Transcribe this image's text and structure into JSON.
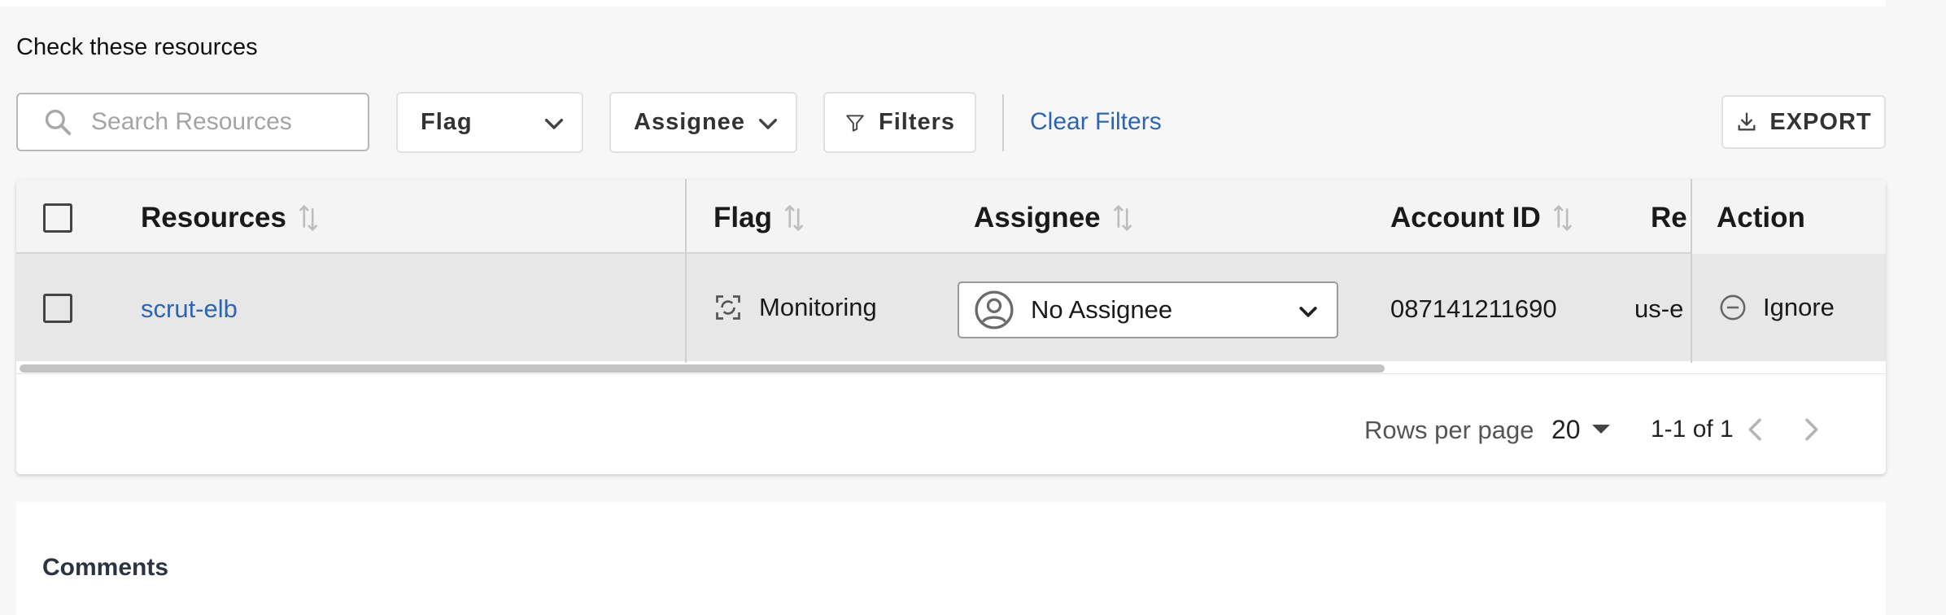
{
  "section": {
    "title": "Check these resources"
  },
  "toolbar": {
    "search_placeholder": "Search Resources",
    "flag_label": "Flag",
    "assignee_label": "Assignee",
    "filters_label": "Filters",
    "clear_filters_label": "Clear Filters",
    "export_label": "EXPORT"
  },
  "table": {
    "columns": [
      "Resources",
      "Flag",
      "Assignee",
      "Account ID",
      "Reg",
      "Action"
    ],
    "rows": [
      {
        "resource": "scrut-elb",
        "flag": "Monitoring",
        "assignee": "No Assignee",
        "account_id": "087141211690",
        "region": "us-e",
        "action": "Ignore"
      }
    ]
  },
  "pagination": {
    "rows_per_page_label": "Rows per page",
    "rows_per_page_value": "20",
    "range": "1-1 of 1"
  },
  "comments": {
    "title": "Comments"
  },
  "colors": {
    "link": "#2f65ae",
    "header_bg": "#f4f4f4",
    "row_bg": "#e7e7e7",
    "page_bg": "#f7f7f7"
  }
}
